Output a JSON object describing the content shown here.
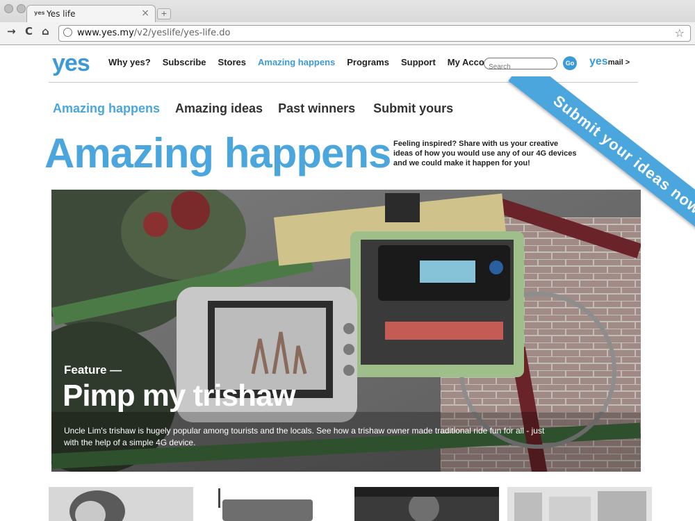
{
  "browser": {
    "tab_title": "Yes life",
    "tab_favicon": "yes",
    "url_host": "www.yes.my",
    "url_path": "/v2/yeslife/yes-life.do"
  },
  "header": {
    "logo": "yes",
    "nav": [
      "Why yes?",
      "Subscribe",
      "Stores",
      "Amazing happens",
      "Programs",
      "Support",
      "My Account"
    ],
    "search_placeholder": "Search",
    "go_label": "Go",
    "yesmail_brand": "yes",
    "yesmail_label": "mail >"
  },
  "subnav": [
    "Amazing happens",
    "Amazing ideas",
    "Past winners",
    "Submit yours"
  ],
  "hero": {
    "title": "Amazing happens",
    "description": "Feeling inspired? Share with us your creative ideas of how you would use any of our 4G devices and we could make it happen for you!"
  },
  "ribbon": {
    "label": "Submit your ideas now"
  },
  "feature": {
    "label": "Feature —",
    "title": "Pimp my trishaw",
    "description": "Uncle Lim's trishaw is hugely popular among tourists and the locals. See how a trishaw owner made traditional ride fun for all - just with the help of a simple 4G device."
  },
  "colors": {
    "brand_blue": "#4aa6dd"
  }
}
